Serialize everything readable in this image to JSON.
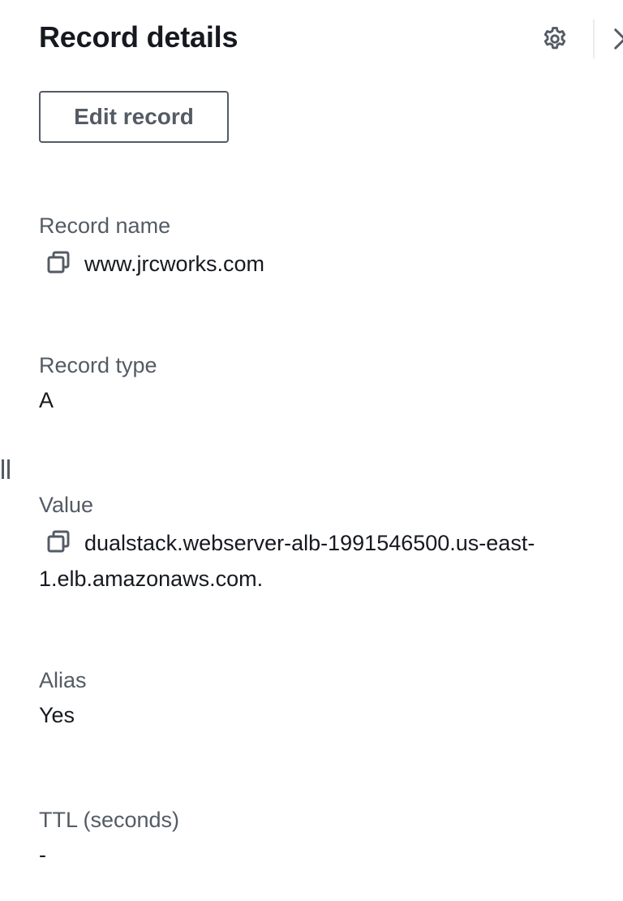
{
  "panel": {
    "title": "Record details",
    "settings_icon": "gear-icon",
    "close_icon": "close-icon"
  },
  "actions": {
    "edit_label": "Edit record"
  },
  "fields": {
    "record_name": {
      "label": "Record name",
      "value": "www.jrcworks.com"
    },
    "record_type": {
      "label": "Record type",
      "value": "A"
    },
    "value": {
      "label": "Value",
      "value_line1": "dualstack.webserver-alb-1991546500.us-east-",
      "value_line2": "1.elb.amazonaws.com."
    },
    "alias": {
      "label": "Alias",
      "value": "Yes"
    },
    "ttl": {
      "label": "TTL (seconds)",
      "value": "-"
    }
  },
  "colors": {
    "text": "#16191f",
    "label": "#545b64",
    "border": "#545b64",
    "divider": "#eaeded"
  }
}
